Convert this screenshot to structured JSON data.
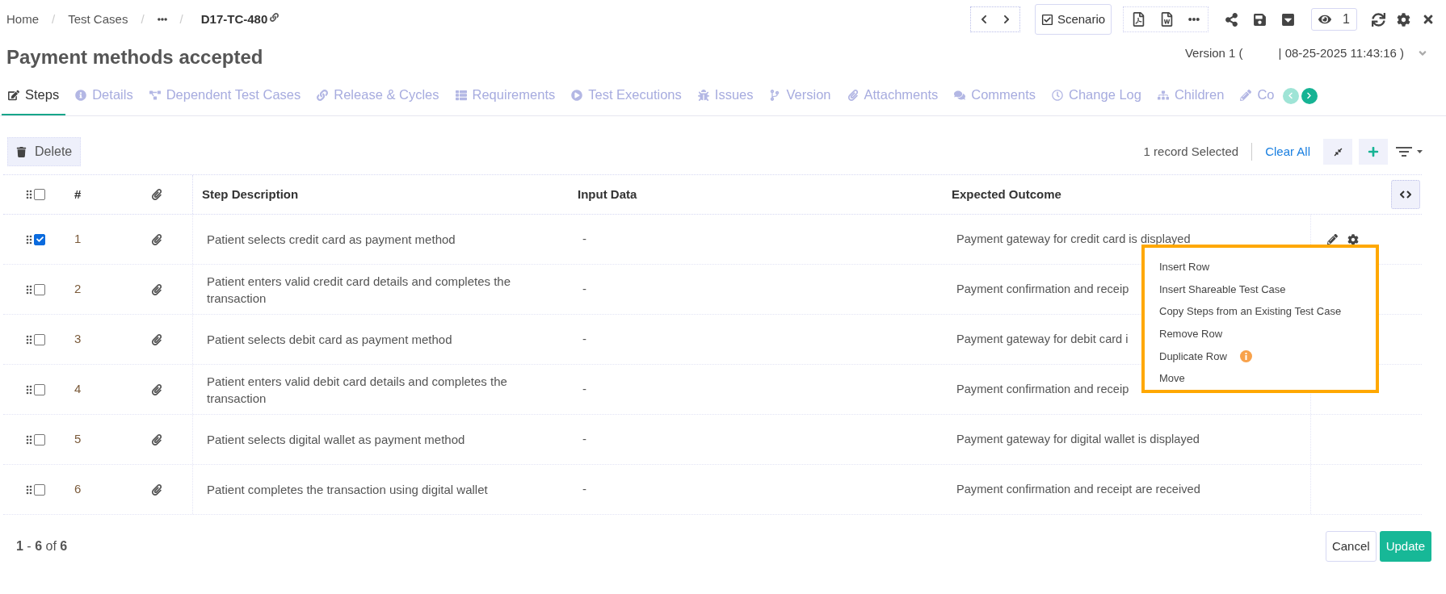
{
  "breadcrumb": {
    "items": [
      "Home",
      "Test Cases"
    ],
    "current": "D17-TC-480",
    "separator": "/"
  },
  "toolbar": {
    "scenario": "Scenario",
    "watchers": "1"
  },
  "title": "Payment methods accepted",
  "version": {
    "label": "Version 1 (",
    "timestamp": "| 08-25-2025 11:43:16 )"
  },
  "tabs": [
    {
      "label": "Steps",
      "selected": true
    },
    {
      "label": "Details",
      "selected": false
    },
    {
      "label": "Dependent Test Cases",
      "selected": false
    },
    {
      "label": "Release & Cycles",
      "selected": false
    },
    {
      "label": "Requirements",
      "selected": false
    },
    {
      "label": "Test Executions",
      "selected": false
    },
    {
      "label": "Issues",
      "selected": false
    },
    {
      "label": "Version",
      "selected": false
    },
    {
      "label": "Attachments",
      "selected": false
    },
    {
      "label": "Comments",
      "selected": false
    },
    {
      "label": "Change Log",
      "selected": false
    },
    {
      "label": "Children",
      "selected": false
    },
    {
      "label": "Co",
      "selected": false
    }
  ],
  "actions": {
    "delete": "Delete",
    "selection": "1 record Selected",
    "clear": "Clear All"
  },
  "table": {
    "columns": [
      "#",
      "Step Description",
      "Input Data",
      "Expected Outcome"
    ],
    "all_checked": false,
    "rows": [
      {
        "number": "1",
        "description": "Patient selects credit card as payment method",
        "input": "-",
        "outcome": "Payment gateway for credit card is displayed",
        "checked": true,
        "hovered": true
      },
      {
        "number": "2",
        "description": "Patient enters valid credit card details and completes the transaction",
        "input": "-",
        "outcome": "Payment confirmation and receip",
        "checked": false,
        "hovered": false
      },
      {
        "number": "3",
        "description": "Patient selects debit card as payment method",
        "input": "-",
        "outcome": "Payment gateway for debit card i",
        "checked": false,
        "hovered": false
      },
      {
        "number": "4",
        "description": "Patient enters valid debit card details and completes the transaction",
        "input": "-",
        "outcome": "Payment confirmation and receip",
        "checked": false,
        "hovered": false
      },
      {
        "number": "5",
        "description": "Patient selects digital wallet as payment method",
        "input": "-",
        "outcome": "Payment gateway for digital wallet is displayed",
        "checked": false,
        "hovered": false
      },
      {
        "number": "6",
        "description": "Patient completes the transaction using digital wallet",
        "input": "-",
        "outcome": "Payment confirmation and receipt are received",
        "checked": false,
        "hovered": false
      }
    ]
  },
  "context_menu": [
    {
      "label": "Insert Row",
      "info": false
    },
    {
      "label": "Insert Shareable Test Case",
      "info": false
    },
    {
      "label": "Copy Steps from an Existing Test Case",
      "info": false
    },
    {
      "label": "Remove Row",
      "info": false
    },
    {
      "label": "Duplicate Row",
      "info": true
    },
    {
      "label": "Move",
      "info": false
    }
  ],
  "pagination": "**1** - **6** of **6**",
  "buttons": {
    "cancel": "Cancel",
    "update": "Update"
  }
}
